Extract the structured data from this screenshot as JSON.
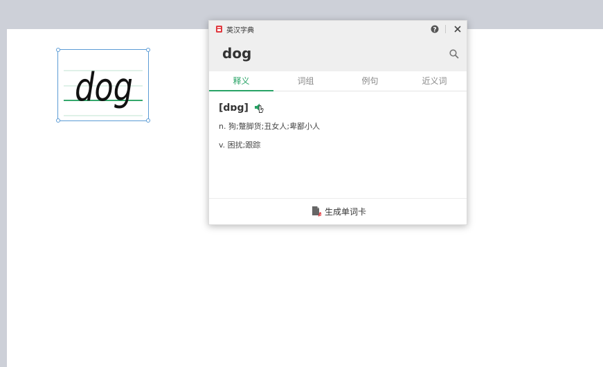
{
  "canvas": {
    "word_card": {
      "text": "dog"
    }
  },
  "popup": {
    "app_title": "英汉字典",
    "query": "dog",
    "tabs": [
      {
        "label": "释义",
        "active": true
      },
      {
        "label": "词组",
        "active": false
      },
      {
        "label": "例句",
        "active": false
      },
      {
        "label": "近义词",
        "active": false
      }
    ],
    "phonetic": "[dɒg]",
    "definitions": [
      "n. 狗;蹩脚货;丑女人;卑鄙小人",
      "v. 困扰;跟踪"
    ],
    "footer_button": "生成单词卡"
  },
  "colors": {
    "accent": "#27a365",
    "selection": "#5b9bd5",
    "app_icon": "#e0383e"
  },
  "icons": [
    "app-icon",
    "help-icon",
    "close-icon",
    "search-icon",
    "speaker-icon",
    "word-card-icon",
    "cursor-hand-icon"
  ]
}
